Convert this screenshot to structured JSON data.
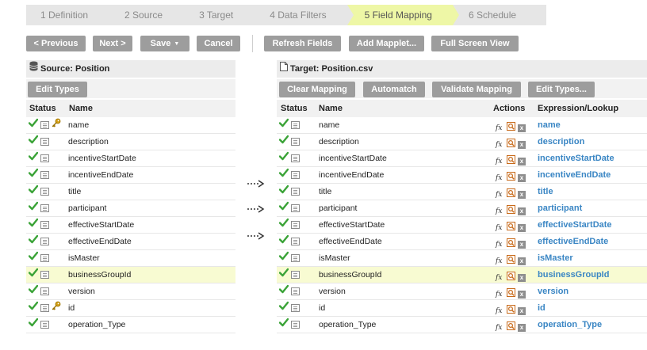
{
  "wizard": {
    "steps": [
      {
        "label": "1 Definition"
      },
      {
        "label": "2 Source"
      },
      {
        "label": "3 Target"
      },
      {
        "label": "4 Data Filters"
      },
      {
        "label": "5 Field Mapping"
      },
      {
        "label": "6 Schedule"
      }
    ],
    "active_step": "5 Field Mapping"
  },
  "toolbar": {
    "previous_label": "< Previous",
    "next_label": "Next >",
    "save_label": "Save",
    "cancel_label": "Cancel",
    "refresh_label": "Refresh Fields",
    "mapplet_label": "Add Mapplet...",
    "fullscreen_label": "Full Screen View"
  },
  "source": {
    "title": "Source: Position",
    "edit_types_label": "Edit Types",
    "columns": {
      "status": "Status",
      "name": "Name"
    },
    "rows": [
      {
        "name": "name",
        "key": true
      },
      {
        "name": "description",
        "key": false
      },
      {
        "name": "incentiveStartDate",
        "key": false
      },
      {
        "name": "incentiveEndDate",
        "key": false
      },
      {
        "name": "title",
        "key": false
      },
      {
        "name": "participant",
        "key": false
      },
      {
        "name": "effectiveStartDate",
        "key": false
      },
      {
        "name": "effectiveEndDate",
        "key": false
      },
      {
        "name": "isMaster",
        "key": false
      },
      {
        "name": "businessGroupId",
        "key": false
      },
      {
        "name": "version",
        "key": false
      },
      {
        "name": "id",
        "key": true
      },
      {
        "name": "operation_Type",
        "key": false
      }
    ]
  },
  "target": {
    "title": "Target: Position.csv",
    "buttons": {
      "clear": "Clear Mapping",
      "automatch": "Automatch",
      "validate": "Validate Mapping",
      "edit_types": "Edit Types..."
    },
    "columns": {
      "status": "Status",
      "name": "Name",
      "actions": "Actions",
      "expression": "Expression/Lookup"
    },
    "rows": [
      {
        "name": "name",
        "expression": "name"
      },
      {
        "name": "description",
        "expression": "description"
      },
      {
        "name": "incentiveStartDate",
        "expression": "incentiveStartDate"
      },
      {
        "name": "incentiveEndDate",
        "expression": "incentiveEndDate"
      },
      {
        "name": "title",
        "expression": "title"
      },
      {
        "name": "participant",
        "expression": "participant"
      },
      {
        "name": "effectiveStartDate",
        "expression": "effectiveStartDate"
      },
      {
        "name": "effectiveEndDate",
        "expression": "effectiveEndDate"
      },
      {
        "name": "isMaster",
        "expression": "isMaster"
      },
      {
        "name": "businessGroupId",
        "expression": "businessGroupId"
      },
      {
        "name": "version",
        "expression": "version"
      },
      {
        "name": "id",
        "expression": "id"
      },
      {
        "name": "operation_Type",
        "expression": "operation_Type"
      }
    ],
    "fx_symbol": "fx",
    "remove_symbol": "x"
  },
  "highlighted_field": "businessGroupId",
  "colors": {
    "accent_step": "#eef7a6",
    "expression_link": "#3a86c4",
    "check": "#3aa337",
    "highlight_row": "#f8fbd2",
    "button": "#9d9d9d"
  }
}
